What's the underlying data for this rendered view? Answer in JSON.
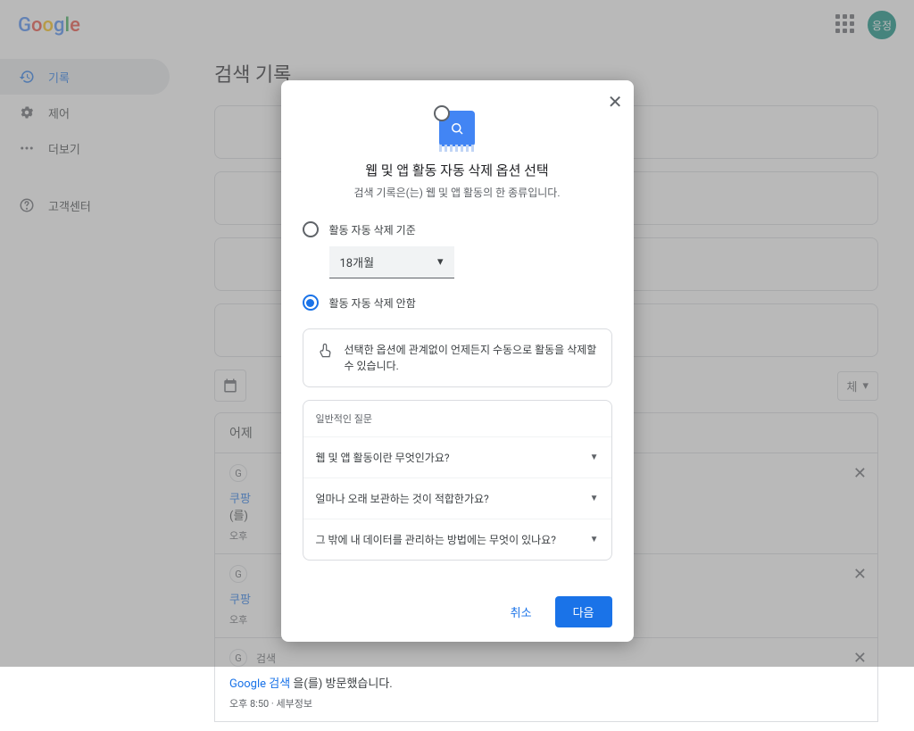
{
  "header": {
    "logo": "Google",
    "avatar_text": "응정"
  },
  "sidebar": {
    "items": [
      {
        "label": "기록",
        "icon": "history-icon"
      },
      {
        "label": "제어",
        "icon": "gear-icon"
      },
      {
        "label": "더보기",
        "icon": "more-icon"
      }
    ],
    "help": {
      "label": "고객센터",
      "icon": "help-icon"
    }
  },
  "content": {
    "page_title": "검색 기록",
    "yesterday_label": "어제",
    "dropdown_partial": "체",
    "activity1": {
      "title_part1": "쿠팡",
      "title_part2": "(를)",
      "time": "오후"
    },
    "activity2": {
      "title": "쿠팡",
      "time": "오후"
    },
    "activity3": {
      "badge": "검색",
      "link_prefix": "Google 검색",
      "link_suffix": "을(를) 방문했습니다.",
      "time": "오후 8:50 · 세부정보"
    }
  },
  "modal": {
    "title": "웹 및 앱 활동 자동 삭제 옵션 선택",
    "subtitle": "검색 기록은(는) 웹 및 앱 활동의 한 종류입니다.",
    "option1_label": "활동 자동 삭제 기준",
    "duration": "18개월",
    "option2_label": "활동 자동 삭제 안함",
    "info_text": "선택한 옵션에 관계없이 언제든지 수동으로 활동을 삭제할 수 있습니다.",
    "faq_header": "일반적인 질문",
    "faq_items": [
      "웹 및 앱 활동이란 무엇인가요?",
      "얼마나 오래 보관하는 것이 적합한가요?",
      "그 밖에 내 데이터를 관리하는 방법에는 무엇이 있나요?"
    ],
    "cancel": "취소",
    "next": "다음"
  }
}
